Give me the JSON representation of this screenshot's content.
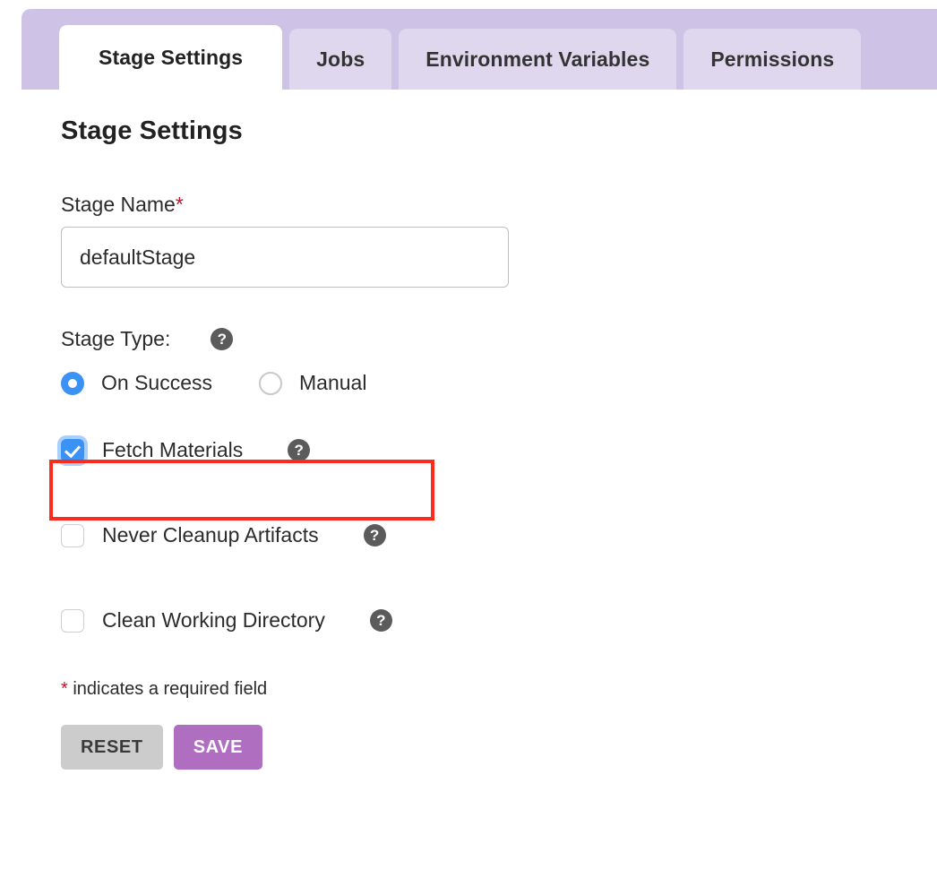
{
  "tabs": [
    {
      "label": "Stage Settings",
      "active": true
    },
    {
      "label": "Jobs",
      "active": false
    },
    {
      "label": "Environment Variables",
      "active": false
    },
    {
      "label": "Permissions",
      "active": false
    }
  ],
  "page": {
    "title": "Stage Settings"
  },
  "stage_name": {
    "label": "Stage Name",
    "required_marker": "*",
    "value": "defaultStage",
    "placeholder": ""
  },
  "stage_type": {
    "label": "Stage Type:",
    "help_icon": "question-mark-icon",
    "help_glyph": "?",
    "options": [
      {
        "label": "On Success",
        "selected": true
      },
      {
        "label": "Manual",
        "selected": false
      }
    ]
  },
  "checkboxes": [
    {
      "label": "Fetch Materials",
      "checked": true,
      "help_glyph": "?",
      "highlighted": true
    },
    {
      "label": "Never Cleanup Artifacts",
      "checked": false,
      "help_glyph": "?",
      "highlighted": false
    },
    {
      "label": "Clean Working Directory",
      "checked": false,
      "help_glyph": "?",
      "highlighted": false
    }
  ],
  "footer": {
    "required_marker": "*",
    "required_note": " indicates a required field",
    "reset_label": "RESET",
    "save_label": "SAVE"
  },
  "colors": {
    "tabbar_bg": "#cec2e7",
    "tab_inactive_bg": "#ded7ee",
    "tab_active_bg": "#ffffff",
    "accent_blue": "#3b92f5",
    "save_purple": "#b06ec0",
    "reset_gray": "#cccccc",
    "required_red": "#c8102e",
    "highlight_red": "#fc2c1c",
    "help_icon_gray": "#5b5b5b"
  }
}
